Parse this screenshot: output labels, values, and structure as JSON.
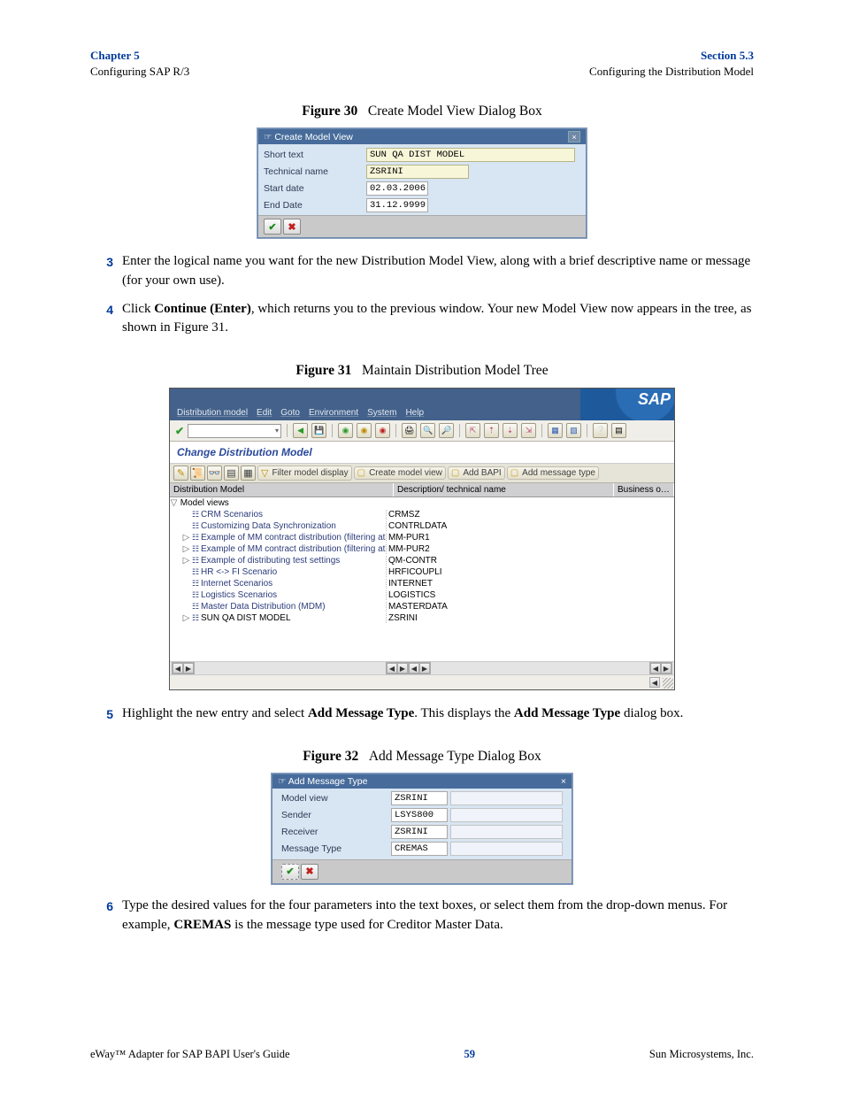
{
  "header": {
    "chapter": "Chapter 5",
    "chapter_sub": "Configuring SAP R/3",
    "section": "Section 5.3",
    "section_sub": "Configuring the Distribution Model"
  },
  "fig30": {
    "caption_bold": "Figure 30",
    "caption_rest": "Create Model View Dialog Box",
    "title": "Create Model View",
    "rows": {
      "short_text": {
        "label": "Short text",
        "value": "SUN QA DIST MODEL"
      },
      "technical_name": {
        "label": "Technical name",
        "value": "ZSRINI"
      },
      "start_date": {
        "label": "Start date",
        "value": "02.03.2006"
      },
      "end_date": {
        "label": "End Date",
        "value": "31.12.9999"
      }
    }
  },
  "step3": {
    "num": "3",
    "text": "Enter the logical name you want for the new Distribution Model View, along with a brief descriptive name or message (for your own use)."
  },
  "step4": {
    "num": "4",
    "text_a": "Click ",
    "text_b": "Continue (Enter)",
    "text_c": ", which returns you to the previous window. Your new Model View now appears in the tree, as shown in Figure 31."
  },
  "fig31": {
    "caption_bold": "Figure 31",
    "caption_rest": "Maintain Distribution Model Tree",
    "menu": [
      "Distribution model",
      "Edit",
      "Goto",
      "Environment",
      "System",
      "Help"
    ],
    "subtitle": "Change Distribution Model",
    "toolbar2": {
      "filter": "Filter model display",
      "create": "Create model view",
      "add_bapi": "Add BAPI",
      "add_msg": "Add message type"
    },
    "grid_head": {
      "col1": "Distribution Model",
      "col2": "Description/ technical name",
      "col3": "Business o…"
    },
    "tree": {
      "root": "Model views",
      "items": [
        {
          "name": "CRM Scenarios",
          "code": "CRMSZ",
          "tog": ""
        },
        {
          "name": "Customizing Data Synchronization",
          "code": "CONTRLDATA",
          "tog": ""
        },
        {
          "name": "Example of MM contract distribution (filtering at hea",
          "code": "MM-PUR1",
          "tog": "▷"
        },
        {
          "name": "Example of MM contract distribution (filtering at iten",
          "code": "MM-PUR2",
          "tog": "▷"
        },
        {
          "name": "Example of distributing test settings",
          "code": "QM-CONTR",
          "tog": "▷"
        },
        {
          "name": "HR <-> FI Scenario",
          "code": "HRFICOUPLI",
          "tog": ""
        },
        {
          "name": "Internet Scenarios",
          "code": "INTERNET",
          "tog": ""
        },
        {
          "name": "Logistics Scenarios",
          "code": "LOGISTICS",
          "tog": ""
        },
        {
          "name": "Master Data Distribution (MDM)",
          "code": "MASTERDATA",
          "tog": ""
        },
        {
          "name": "SUN QA DIST MODEL",
          "code": "ZSRINI",
          "tog": "▷",
          "dark": true
        }
      ]
    }
  },
  "step5": {
    "num": "5",
    "text_a": "Highlight the new entry and select ",
    "text_b": "Add Message Type",
    "text_c": ". This displays the ",
    "text_d": "Add Message Type",
    "text_e": " dialog box."
  },
  "fig32": {
    "caption_bold": "Figure 32",
    "caption_rest": "Add Message Type Dialog Box",
    "title": "Add Message Type",
    "rows": {
      "model_view": {
        "label": "Model view",
        "value": "ZSRINI"
      },
      "sender": {
        "label": "Sender",
        "value": "LSYS800"
      },
      "receiver": {
        "label": "Receiver",
        "value": "ZSRINI"
      },
      "message_type": {
        "label": "Message Type",
        "value": "CREMAS"
      }
    }
  },
  "step6": {
    "num": "6",
    "text_a": "Type the desired values for the four parameters into the text boxes, or select them from the drop-down menus. For example, ",
    "text_b": "CREMAS",
    "text_c": " is the message type used for Creditor Master Data."
  },
  "footer": {
    "left": "eWay™ Adapter for SAP BAPI User's Guide",
    "page": "59",
    "right": "Sun Microsystems, Inc."
  }
}
